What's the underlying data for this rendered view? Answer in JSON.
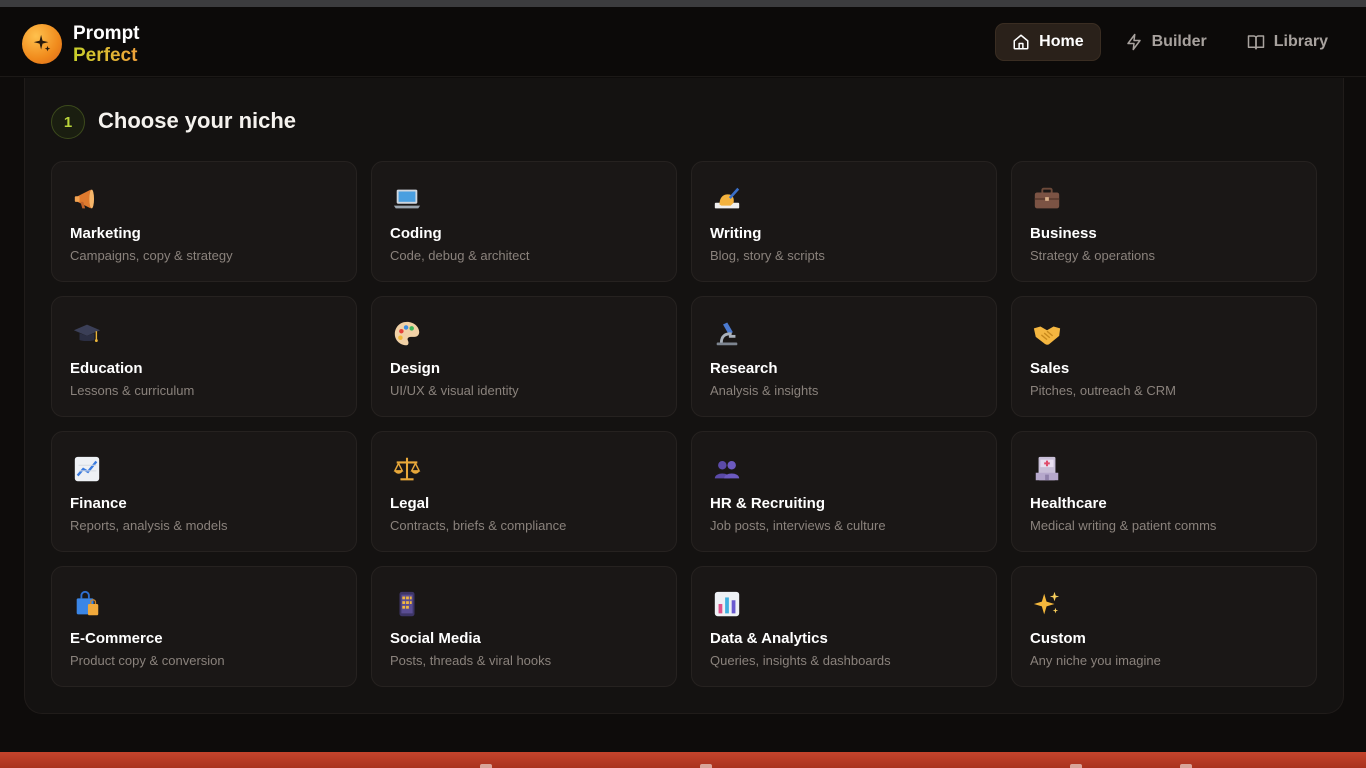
{
  "app": {
    "brand_top": "Prompt",
    "brand_bottom": "Perfect",
    "logo_icon": "sparkle-icon",
    "accent_color": "#f08a1c"
  },
  "nav": {
    "items": [
      {
        "label": "Home",
        "icon": "home-icon",
        "active": true
      },
      {
        "label": "Builder",
        "icon": "lightning-icon",
        "active": false
      },
      {
        "label": "Library",
        "icon": "book-icon",
        "active": false
      }
    ]
  },
  "section": {
    "step_number": "1",
    "title": "Choose your niche"
  },
  "niches": [
    {
      "name": "Marketing",
      "desc": "Campaigns, copy & strategy",
      "icon": "megaphone-icon"
    },
    {
      "name": "Coding",
      "desc": "Code, debug & architect",
      "icon": "laptop-icon"
    },
    {
      "name": "Writing",
      "desc": "Blog, story & scripts",
      "icon": "writing-hand-icon"
    },
    {
      "name": "Business",
      "desc": "Strategy & operations",
      "icon": "briefcase-icon"
    },
    {
      "name": "Education",
      "desc": "Lessons & curriculum",
      "icon": "graduation-cap-icon"
    },
    {
      "name": "Design",
      "desc": "UI/UX & visual identity",
      "icon": "palette-icon"
    },
    {
      "name": "Research",
      "desc": "Analysis & insights",
      "icon": "microscope-icon"
    },
    {
      "name": "Sales",
      "desc": "Pitches, outreach & CRM",
      "icon": "handshake-icon"
    },
    {
      "name": "Finance",
      "desc": "Reports, analysis & models",
      "icon": "chart-up-icon"
    },
    {
      "name": "Legal",
      "desc": "Contracts, briefs & compliance",
      "icon": "scales-icon"
    },
    {
      "name": "HR & Recruiting",
      "desc": "Job posts, interviews & culture",
      "icon": "people-icon"
    },
    {
      "name": "Healthcare",
      "desc": "Medical writing & patient comms",
      "icon": "hospital-icon"
    },
    {
      "name": "E-Commerce",
      "desc": "Product copy & conversion",
      "icon": "shopping-bags-icon"
    },
    {
      "name": "Social Media",
      "desc": "Posts, threads & viral hooks",
      "icon": "phone-icon"
    },
    {
      "name": "Data & Analytics",
      "desc": "Queries, insights & dashboards",
      "icon": "bar-chart-icon"
    },
    {
      "name": "Custom",
      "desc": "Any niche you imagine",
      "icon": "sparkles-icon"
    }
  ]
}
